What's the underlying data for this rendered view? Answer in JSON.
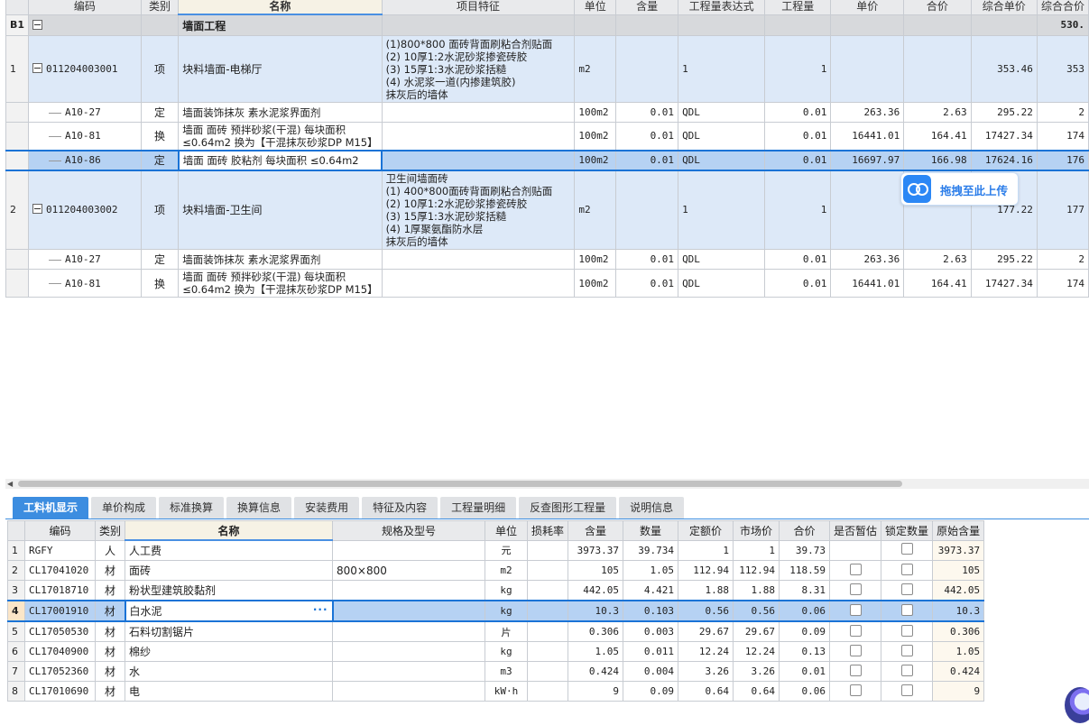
{
  "top_grid": {
    "columns": [
      "编码",
      "类别",
      "名称",
      "项目特征",
      "单位",
      "含量",
      "工程量表达式",
      "工程量",
      "单价",
      "合价",
      "综合单价",
      "综合合价"
    ],
    "group": {
      "idx": "B1",
      "name": "墙面工程",
      "total": "530."
    },
    "rows": [
      {
        "kind": "item",
        "idx": "1",
        "code": "011204003001",
        "type": "项",
        "name": "块料墙面-电梯厅",
        "feature": [
          "(1)800*800 面砖背面刷粘合剂贴面",
          "(2) 10厚1:2水泥砂浆掺瓷砖胶",
          "(3) 15厚1:3水泥砂浆括糙",
          "(4) 水泥浆一道(内掺建筑胶)",
          "抹灰后的墙体"
        ],
        "unit": "m2",
        "content": "",
        "expr": "1",
        "qty": "1",
        "price": "",
        "total": "",
        "comp_price": "353.46",
        "comp_total": "353"
      },
      {
        "kind": "sub",
        "idx": "",
        "code": "A10-27",
        "type": "定",
        "name": [
          "墙面装饰抹灰 素水泥浆界面剂"
        ],
        "feature": [],
        "unit": "100m2",
        "content": "0.01",
        "expr": "QDL",
        "qty": "0.01",
        "price": "263.36",
        "total": "2.63",
        "comp_price": "295.22",
        "comp_total": "2"
      },
      {
        "kind": "sub",
        "idx": "",
        "code": "A10-81",
        "type": "换",
        "name": [
          "墙面 面砖 预拌砂浆(干混) 每块面积",
          "≤0.64m2  换为【干混抹灰砂浆DP M15】"
        ],
        "feature": [],
        "unit": "100m2",
        "content": "0.01",
        "expr": "QDL",
        "qty": "0.01",
        "price": "16441.01",
        "total": "164.41",
        "comp_price": "17427.34",
        "comp_total": "174"
      },
      {
        "kind": "sel",
        "idx": "",
        "code": "A10-86",
        "type": "定",
        "name": [
          "墙面 面砖 胶粘剂 每块面积 ≤0.64m2"
        ],
        "feature": [],
        "unit": "100m2",
        "content": "0.01",
        "expr": "QDL",
        "qty": "0.01",
        "price": "16697.97",
        "total": "166.98",
        "comp_price": "17624.16",
        "comp_total": "176"
      },
      {
        "kind": "item",
        "idx": "2",
        "code": "011204003002",
        "type": "项",
        "name": "块料墙面-卫生间",
        "feature": [
          "卫生间墙面砖",
          "(1) 400*800面砖背面刷粘合剂贴面",
          "(2) 10厚1:2水泥砂浆掺瓷砖胶",
          "(3) 15厚1:3水泥砂浆括糙",
          "(4) 1厚聚氨酯防水层",
          "抹灰后的墙体"
        ],
        "unit": "m2",
        "content": "",
        "expr": "1",
        "qty": "1",
        "price": "",
        "total": "",
        "comp_price": "177.22",
        "comp_total": "177"
      },
      {
        "kind": "sub",
        "idx": "",
        "code": "A10-27",
        "type": "定",
        "name": [
          "墙面装饰抹灰 素水泥浆界面剂"
        ],
        "feature": [],
        "unit": "100m2",
        "content": "0.01",
        "expr": "QDL",
        "qty": "0.01",
        "price": "263.36",
        "total": "2.63",
        "comp_price": "295.22",
        "comp_total": "2"
      },
      {
        "kind": "sub",
        "idx": "",
        "code": "A10-81",
        "type": "换",
        "name": [
          "墙面 面砖 预拌砂浆(干混) 每块面积",
          "≤0.64m2  换为【干混抹灰砂浆DP M15】"
        ],
        "feature": [],
        "unit": "100m2",
        "content": "0.01",
        "expr": "QDL",
        "qty": "0.01",
        "price": "16441.01",
        "total": "164.41",
        "comp_price": "17427.34",
        "comp_total": "174"
      }
    ]
  },
  "tabs": [
    "工料机显示",
    "单价构成",
    "标准换算",
    "换算信息",
    "安装费用",
    "特征及内容",
    "工程量明细",
    "反查图形工程量",
    "说明信息"
  ],
  "active_tab": 0,
  "bottom_grid": {
    "columns": [
      "编码",
      "类别",
      "名称",
      "规格及型号",
      "单位",
      "损耗率",
      "含量",
      "数量",
      "定额价",
      "市场价",
      "合价",
      "是否暂估",
      "锁定数量",
      "原始含量"
    ],
    "rows": [
      {
        "idx": "1",
        "code": "RGFY",
        "type": "人",
        "name": "人工费",
        "spec": "",
        "unit": "元",
        "loss": "",
        "content": "3973.37",
        "qty": "39.734",
        "quota": "1",
        "market": "1",
        "total": "39.73",
        "est": false,
        "lock": true,
        "orig": "3973.37"
      },
      {
        "idx": "2",
        "code": "CL17041020",
        "type": "材",
        "name": "面砖",
        "spec": "800×800",
        "unit": "m2",
        "loss": "",
        "content": "105",
        "qty": "1.05",
        "quota": "112.94",
        "market": "112.94",
        "total": "118.59",
        "est": true,
        "lock": true,
        "orig": "105"
      },
      {
        "idx": "3",
        "code": "CL17018710",
        "type": "材",
        "name": "粉状型建筑胶黏剂",
        "spec": "",
        "unit": "kg",
        "loss": "",
        "content": "442.05",
        "qty": "4.421",
        "quota": "1.88",
        "market": "1.88",
        "total": "8.31",
        "est": true,
        "lock": true,
        "orig": "442.05"
      },
      {
        "idx": "4",
        "code": "CL17001910",
        "type": "材",
        "name": "白水泥",
        "spec": "",
        "unit": "kg",
        "loss": "",
        "content": "10.3",
        "qty": "0.103",
        "quota": "0.56",
        "market": "0.56",
        "total": "0.06",
        "est": true,
        "lock": true,
        "orig": "10.3",
        "selected": true
      },
      {
        "idx": "5",
        "code": "CL17050530",
        "type": "材",
        "name": "石料切割锯片",
        "spec": "",
        "unit": "片",
        "loss": "",
        "content": "0.306",
        "qty": "0.003",
        "quota": "29.67",
        "market": "29.67",
        "total": "0.09",
        "est": true,
        "lock": true,
        "orig": "0.306"
      },
      {
        "idx": "6",
        "code": "CL17040900",
        "type": "材",
        "name": "棉纱",
        "spec": "",
        "unit": "kg",
        "loss": "",
        "content": "1.05",
        "qty": "0.011",
        "quota": "12.24",
        "market": "12.24",
        "total": "0.13",
        "est": true,
        "lock": true,
        "orig": "1.05"
      },
      {
        "idx": "7",
        "code": "CL17052360",
        "type": "材",
        "name": "水",
        "spec": "",
        "unit": "m3",
        "loss": "",
        "content": "0.424",
        "qty": "0.004",
        "quota": "3.26",
        "market": "3.26",
        "total": "0.01",
        "est": true,
        "lock": true,
        "orig": "0.424"
      },
      {
        "idx": "8",
        "code": "CL17010690",
        "type": "材",
        "name": "电",
        "spec": "",
        "unit": "kW·h",
        "loss": "",
        "content": "9",
        "qty": "0.09",
        "quota": "0.64",
        "market": "0.64",
        "total": "0.06",
        "est": true,
        "lock": true,
        "orig": "9"
      }
    ]
  },
  "upload_hint": {
    "label": "拖拽至此上传",
    "icon": "cloud-upload-icon"
  },
  "colors": {
    "accent": "#3c8de0",
    "selection": "#b6d2f3",
    "item_row": "#dde9f8"
  }
}
